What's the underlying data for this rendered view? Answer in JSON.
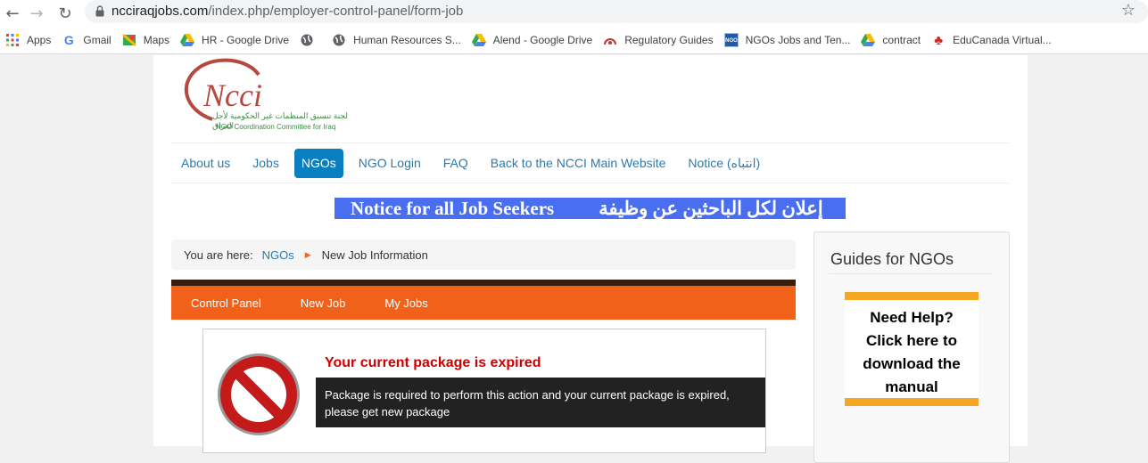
{
  "browser": {
    "url_domain": "ncciraqjobs.com",
    "url_path": "/index.php/employer-control-panel/form-job",
    "bookmarks": [
      {
        "label": "Apps",
        "icon": "apps-grid-icon"
      },
      {
        "label": "Gmail",
        "icon": "google-g-icon"
      },
      {
        "label": "Maps",
        "icon": "maps-icon"
      },
      {
        "label": "HR - Google Drive",
        "icon": "drive-icon"
      },
      {
        "label": "",
        "icon": "globe-icon"
      },
      {
        "label": "Human Resources S...",
        "icon": "globe-icon"
      },
      {
        "label": "Alend - Google Drive",
        "icon": "drive-icon"
      },
      {
        "label": "Regulatory Guides",
        "icon": "regulatory-icon"
      },
      {
        "label": "NGOs Jobs and Ten...",
        "icon": "ngo-icon"
      },
      {
        "label": "contract",
        "icon": "drive-icon"
      },
      {
        "label": "EduCanada Virtual...",
        "icon": "maple-leaf-icon"
      }
    ]
  },
  "logo": {
    "arabic": "لجنة تنسيق المنظمات غير الحكومية لأجل العراق",
    "english": "NGO Coordination Committee for Iraq"
  },
  "menu": [
    "About us",
    "Jobs",
    "NGOs",
    "NGO Login",
    "FAQ",
    "Back to the NCCI Main Website",
    "Notice (انتباه)"
  ],
  "notice": {
    "english": "Notice for all Job Seekers",
    "arabic": "إعلان لكل الباحثين عن وظيفة"
  },
  "breadcrumb": {
    "prefix": "You are here:",
    "link": "NGOs",
    "current": "New Job Information"
  },
  "toolbar": [
    "Control Panel",
    "New Job",
    "My Jobs"
  ],
  "alert": {
    "title": "Your current package is expired",
    "message": "Package is required to perform this action and your current package is expired, please get new package"
  },
  "sidebar": {
    "title": "Guides for NGOs",
    "help_lines": [
      "Need Help?",
      "Click here to",
      "download the",
      "manual"
    ]
  },
  "colors": {
    "orange": "#f26119",
    "active_nav": "#0a7fc0",
    "notice_bg": "#4a6ef0"
  }
}
